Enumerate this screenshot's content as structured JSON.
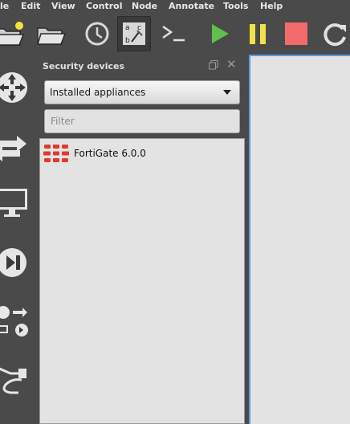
{
  "menu": {
    "items": [
      "le",
      "Edit",
      "View",
      "Control",
      "Node",
      "Annotate",
      "Tools",
      "Help"
    ]
  },
  "toolbar": {
    "buttons": [
      {
        "icon": "new-project-icon"
      },
      {
        "icon": "open-project-icon"
      },
      {
        "icon": "snapshot-clock-icon"
      },
      {
        "icon": "show-interface-labels-icon"
      },
      {
        "icon": "console-icon",
        "text": ">_"
      },
      {
        "icon": "start-icon",
        "color": "#5fbf4f"
      },
      {
        "icon": "pause-icon",
        "color": "#f2e14a"
      },
      {
        "icon": "stop-icon",
        "color": "#f26a6a"
      },
      {
        "icon": "reload-icon"
      }
    ]
  },
  "sidebar": {
    "buttons": [
      {
        "icon": "routers-icon"
      },
      {
        "icon": "switches-icon"
      },
      {
        "icon": "end-devices-icon"
      },
      {
        "icon": "security-devices-icon"
      },
      {
        "icon": "all-devices-icon"
      },
      {
        "icon": "add-link-icon"
      }
    ]
  },
  "dock": {
    "title": "Security devices",
    "select_value": "Installed appliances",
    "filter_placeholder": "Filter",
    "items": [
      {
        "label": "FortiGate 6.0.0",
        "icon": "fortigate-icon",
        "icon_color": "#e03a2f"
      }
    ]
  },
  "colors": {
    "background": "#4a4a4a",
    "canvas": "#e3e3e3",
    "canvas_border": "#5a9bd8"
  }
}
